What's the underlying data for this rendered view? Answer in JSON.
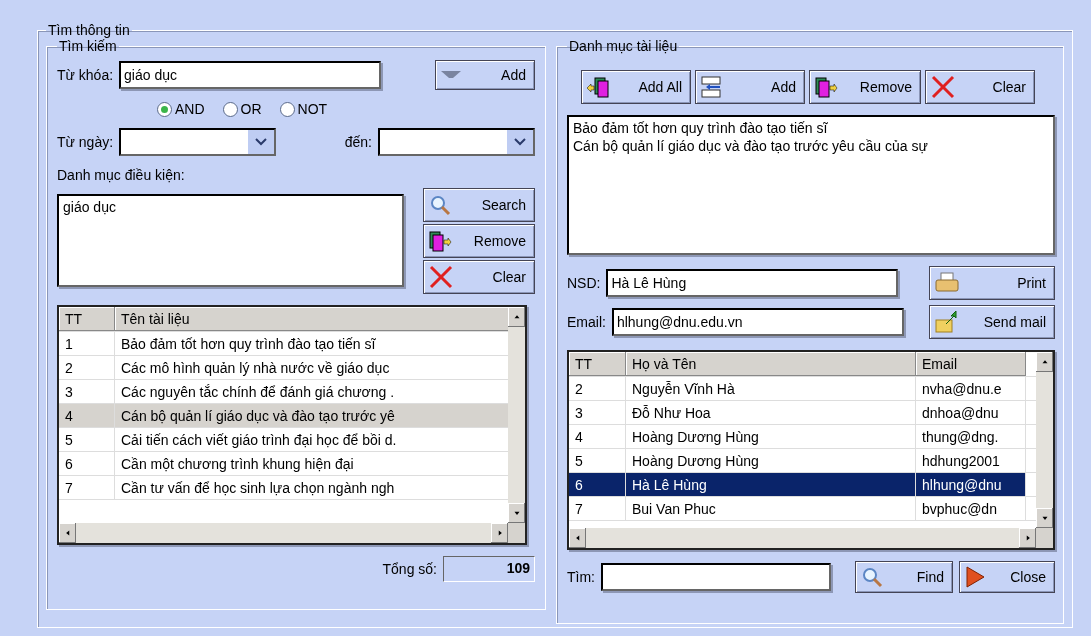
{
  "frame": {
    "title": "Tìm thông tin"
  },
  "search": {
    "title": "Tìm kiếm",
    "keyword": {
      "label": "Từ khóa:",
      "value": "giáo dục"
    },
    "add_button": "Add",
    "operators": [
      {
        "label": "AND",
        "selected": true
      },
      {
        "label": "OR",
        "selected": false
      },
      {
        "label": "NOT",
        "selected": false
      }
    ],
    "from_date": {
      "label": "Từ ngày:"
    },
    "to_date": {
      "label": "đến:"
    },
    "conditions": {
      "label": "Danh mục điều kiện:",
      "items": [
        "giáo dục"
      ]
    },
    "buttons": [
      {
        "kind": "search",
        "label": "Search"
      },
      {
        "kind": "remove",
        "label": "Remove"
      },
      {
        "kind": "clear",
        "label": "Clear"
      }
    ],
    "table": {
      "columns": [
        "TT",
        "Tên tài liệu"
      ],
      "rows": [
        {
          "cells": [
            "1",
            "Bảo đảm tốt hơn quy trình đào tạo tiến sĩ"
          ],
          "selected": false
        },
        {
          "cells": [
            "2",
            "Các mô hình quản lý nhà nước về giáo dục"
          ],
          "selected": false
        },
        {
          "cells": [
            "3",
            "Các nguyên tắc chính để đánh giá chương ."
          ],
          "selected": false
        },
        {
          "cells": [
            "4",
            "Cán bộ quản lí giáo dục và đào tạo trước yê"
          ],
          "selected": true
        },
        {
          "cells": [
            "5",
            "Cải tiến cách viết giáo trình đại học để bồi d."
          ],
          "selected": false
        },
        {
          "cells": [
            "6",
            "Cần một chương trình khung hiện đại"
          ],
          "selected": false
        },
        {
          "cells": [
            "7",
            "Cần tư vấn để học sinh lựa chọn ngành ngh"
          ],
          "selected": false
        }
      ]
    },
    "total": {
      "label": "Tổng số:",
      "value": "109"
    }
  },
  "documents": {
    "title": "Danh mục tài liệu",
    "toolbar": [
      {
        "kind": "add_all",
        "label": "Add All"
      },
      {
        "kind": "add",
        "label": "Add"
      },
      {
        "kind": "remove",
        "label": "Remove"
      },
      {
        "kind": "clear",
        "label": "Clear"
      }
    ],
    "items": [
      "Bảo đảm tốt hơn quy trình đào tạo tiến sĩ",
      "Cán bộ quản lí giáo dục và đào tạo trước yêu cầu của sự"
    ],
    "user": {
      "label": "NSD:",
      "value": "Hà Lê Hùng"
    },
    "print_button": "Print",
    "email": {
      "label": "Email:",
      "value": "hlhung@dnu.edu.vn"
    },
    "send_button": "Send mail",
    "table": {
      "columns": [
        "TT",
        "Họ và Tên",
        "Email"
      ],
      "rows": [
        {
          "cells": [
            "2",
            "Nguyễn Vĩnh Hà",
            "nvha@dnu.e"
          ],
          "selected": false
        },
        {
          "cells": [
            "3",
            "Đỗ Như Hoa",
            "dnhoa@dnu"
          ],
          "selected": false
        },
        {
          "cells": [
            "4",
            "Hoàng Dương Hùng",
            "thung@dng."
          ],
          "selected": false
        },
        {
          "cells": [
            "5",
            "Hoàng Dương Hùng",
            "hdhung2001"
          ],
          "selected": false
        },
        {
          "cells": [
            "6",
            "Hà Lê Hùng",
            "hlhung@dnu"
          ],
          "selected": true
        },
        {
          "cells": [
            "7",
            "Bui Van Phuc",
            "bvphuc@dn"
          ],
          "selected": false
        }
      ]
    },
    "find": {
      "label": "Tìm:"
    },
    "find_button": "Find",
    "close_button": "Close"
  }
}
